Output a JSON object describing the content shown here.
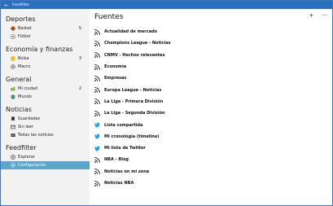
{
  "window": {
    "title": "Feedfilter",
    "back_glyph": "←",
    "minimize": "—",
    "maximize": "□",
    "close": "✕"
  },
  "sidebar": {
    "sections": [
      {
        "title": "Deportes",
        "items": [
          {
            "label": "Basket",
            "count": "5",
            "icon": "basketball-icon"
          },
          {
            "label": "Fútbol",
            "count": "",
            "icon": "soccer-ball-icon"
          }
        ]
      },
      {
        "title": "Economía y finanzas",
        "items": [
          {
            "label": "Bolsa",
            "count": "3",
            "icon": "stock-chart-icon"
          },
          {
            "label": "Macro",
            "count": "",
            "icon": "gear-icon"
          }
        ]
      },
      {
        "title": "General",
        "items": [
          {
            "label": "Mi ciudad",
            "count": "2",
            "icon": "city-icon"
          },
          {
            "label": "Mundo",
            "count": "",
            "icon": "globe-icon"
          }
        ]
      },
      {
        "title": "Noticias",
        "items": [
          {
            "label": "Guardadas",
            "count": "",
            "icon": "bookmark-icon"
          },
          {
            "label": "Sin leer",
            "count": "",
            "icon": "unread-icon"
          },
          {
            "label": "Todas las noticias",
            "count": "",
            "icon": "all-news-icon"
          }
        ]
      },
      {
        "title": "Feedfilter",
        "items": [
          {
            "label": "Explorar",
            "count": "",
            "icon": "compass-icon"
          },
          {
            "label": "Configuración",
            "count": "",
            "icon": "gear-icon",
            "selected": true
          }
        ]
      }
    ]
  },
  "main": {
    "title": "Fuentes",
    "add_glyph": "+",
    "more_glyph": "···",
    "feeds": [
      {
        "label": "Actualidad de mercado",
        "type": "rss"
      },
      {
        "label": "Champions League - Noticias",
        "type": "rss"
      },
      {
        "label": "CNMV - Hechos relevantes",
        "type": "rss"
      },
      {
        "label": "Economía",
        "type": "rss"
      },
      {
        "label": "Empresas",
        "type": "rss"
      },
      {
        "label": "Europa League - Noticias",
        "type": "rss"
      },
      {
        "label": "La Liga - Primera División",
        "type": "rss"
      },
      {
        "label": "La Liga - Segunda División",
        "type": "rss"
      },
      {
        "label": "Lista compartida",
        "type": "twitter"
      },
      {
        "label": "Mi cronología (timeline)",
        "type": "twitter"
      },
      {
        "label": "Mi lista de Twitter",
        "type": "twitter"
      },
      {
        "label": "NBA - Blog",
        "type": "rss"
      },
      {
        "label": "Noticias en mi zona",
        "type": "rss"
      },
      {
        "label": "Noticias NBA",
        "type": "rss"
      }
    ]
  },
  "colors": {
    "titlebar": "#2b6fbf",
    "selected": "#5aa7c9",
    "twitter": "#1da1f2",
    "sidebar_bg": "#f2f2f2"
  }
}
